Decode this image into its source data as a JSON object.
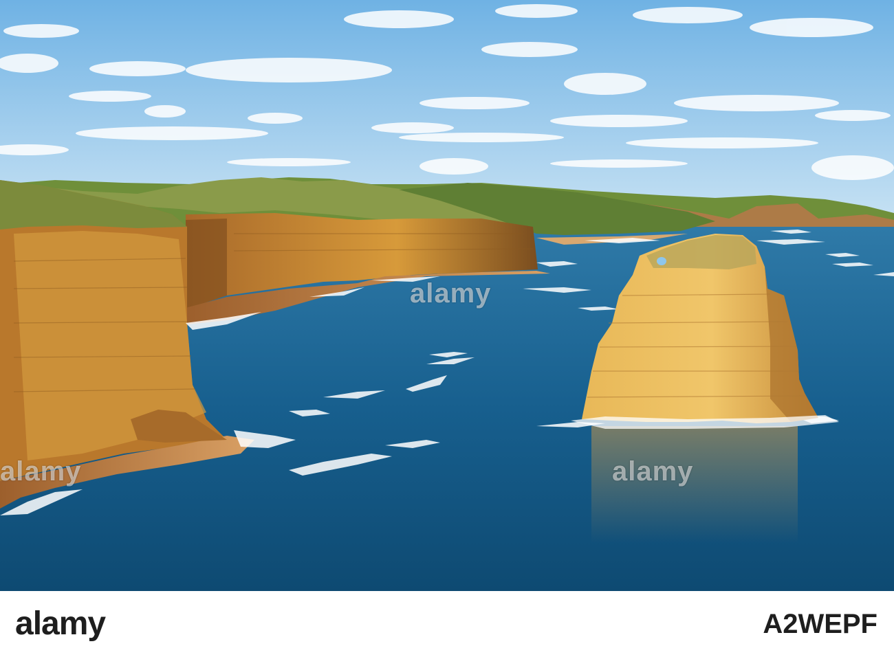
{
  "watermark": {
    "center_text": "alamy",
    "left_text": "alamy",
    "right_text": "alamy"
  },
  "footer": {
    "brand": "alamy",
    "image_code": "A2WEPF"
  },
  "scene": {
    "subject": "limestone-sea-stack",
    "colors": {
      "sky": "#8ec6ec",
      "ocean_deep": "#0f4f7a",
      "ocean_near": "#1a6a96",
      "cliff_lit": "#d79a3a",
      "cliff_shadow": "#8a5a22",
      "beach": "#c88a4a",
      "vegetation": "#6f8f3a"
    }
  }
}
